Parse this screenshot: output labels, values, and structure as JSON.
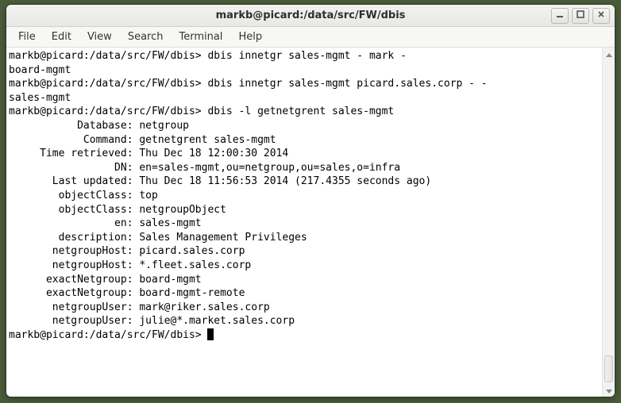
{
  "window": {
    "title": "markb@picard:/data/src/FW/dbis"
  },
  "menu": {
    "file": "File",
    "edit": "Edit",
    "view": "View",
    "search": "Search",
    "terminal": "Terminal",
    "help": "Help"
  },
  "terminal": {
    "lines": [
      "markb@picard:/data/src/FW/dbis> dbis innetgr sales-mgmt - mark -",
      "board-mgmt",
      "markb@picard:/data/src/FW/dbis> dbis innetgr sales-mgmt picard.sales.corp - -",
      "sales-mgmt",
      "markb@picard:/data/src/FW/dbis> dbis -l getnetgrent sales-mgmt",
      "           Database: netgroup",
      "            Command: getnetgrent sales-mgmt",
      "     Time retrieved: Thu Dec 18 12:00:30 2014",
      "",
      "                 DN: en=sales-mgmt,ou=netgroup,ou=sales,o=infra",
      "       Last updated: Thu Dec 18 11:56:53 2014 (217.4355 seconds ago)",
      "        objectClass: top",
      "        objectClass: netgroupObject",
      "                 en: sales-mgmt",
      "        description: Sales Management Privileges",
      "       netgroupHost: picard.sales.corp",
      "       netgroupHost: *.fleet.sales.corp",
      "      exactNetgroup: board-mgmt",
      "      exactNetgroup: board-mgmt-remote",
      "       netgroupUser: mark@riker.sales.corp",
      "       netgroupUser: julie@*.market.sales.corp"
    ],
    "prompt": "markb@picard:/data/src/FW/dbis> "
  }
}
